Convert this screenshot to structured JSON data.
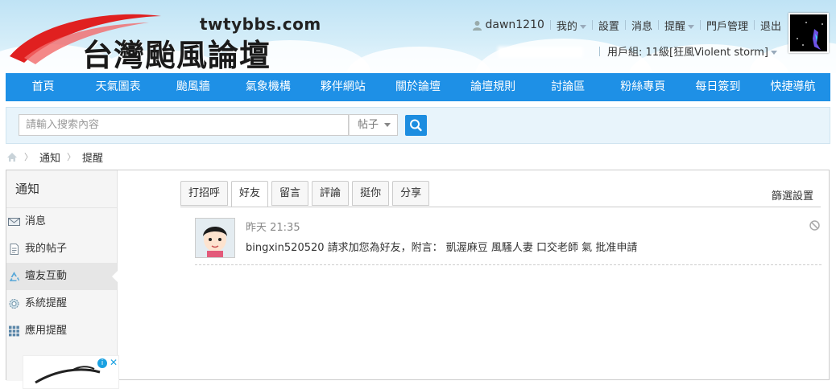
{
  "header": {
    "logo_url": "twtybbs.com",
    "logo_name": "台灣颱風論壇",
    "user": {
      "username": "dawn1210",
      "links": [
        "我的",
        "設置",
        "消息",
        "提醒",
        "門戶管理",
        "退出"
      ]
    },
    "group": {
      "label": "用戶組: 11級[狂風Violent storm]"
    }
  },
  "nav": {
    "items": [
      "首頁",
      "天氣圖表",
      "颱風牆",
      "氣象機構",
      "夥伴網站",
      "關於論壇",
      "論壇規則",
      "討論區",
      "粉絲專頁",
      "每日簽到",
      "快捷導航"
    ]
  },
  "search": {
    "placeholder": "請輸入搜索內容",
    "type": "帖子"
  },
  "breadcrumb": {
    "items": [
      "通知",
      "提醒"
    ]
  },
  "sidebar": {
    "title": "通知",
    "items": [
      {
        "label": "消息",
        "icon": "envelope-icon"
      },
      {
        "label": "我的帖子",
        "icon": "document-icon"
      },
      {
        "label": "壇友互動",
        "icon": "recycle-icon"
      },
      {
        "label": "系統提醒",
        "icon": "gear-icon"
      },
      {
        "label": "應用提醒",
        "icon": "grid-icon"
      }
    ],
    "active_index": 2
  },
  "tabs": {
    "items": [
      "打招呼",
      "好友",
      "留言",
      "評論",
      "挺你",
      "分享"
    ],
    "active_index": 1,
    "filter_label": "篩選設置"
  },
  "notice": {
    "time": "昨天 21:35",
    "text": "bingxin520520 請求加您為好友，附言： 凱渥麻豆 風騷人妻 口交老師 氣 批准申請"
  },
  "colors": {
    "nav_bg": "#1e90e6",
    "search_btn": "#1c8de0",
    "header_sky": "#bfe3f5"
  }
}
